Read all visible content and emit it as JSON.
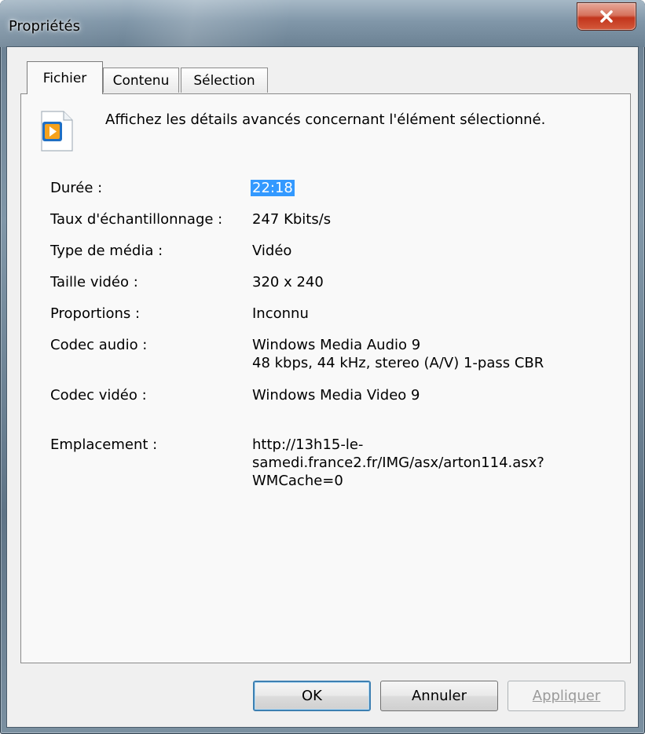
{
  "window": {
    "title": "Propriétés"
  },
  "tabs": [
    {
      "label": "Fichier",
      "active": true
    },
    {
      "label": "Contenu",
      "active": false
    },
    {
      "label": "Sélection",
      "active": false
    }
  ],
  "header": {
    "description": "Affichez les détails avancés concernant l'élément sélectionné.",
    "icon": "media-file-icon"
  },
  "properties": [
    {
      "label": "Durée :",
      "value": "22:18"
    },
    {
      "label": "Taux d'échantillonnage :",
      "value": "247 Kbits/s"
    },
    {
      "label": "Type de média :",
      "value": "Vidéo"
    },
    {
      "label": "Taille vidéo :",
      "value": "320 x 240"
    },
    {
      "label": "Proportions :",
      "value": "Inconnu"
    },
    {
      "label": "Codec audio :",
      "value_lines": [
        "Windows Media Audio 9",
        "48 kbps, 44 kHz, stereo (A/V) 1-pass CBR"
      ]
    },
    {
      "label": "Codec vidéo :",
      "value": "Windows Media Video 9"
    },
    {
      "label": "Emplacement :",
      "value_lines": [
        "http://13h15-le-",
        "samedi.france2.fr/IMG/asx/arton114.asx?",
        "WMCache=0"
      ]
    }
  ],
  "buttons": {
    "ok": "OK",
    "cancel": "Annuler",
    "apply": "Appliquer"
  },
  "colors": {
    "selection": "#3399ff",
    "close_button": "#c2351c"
  }
}
